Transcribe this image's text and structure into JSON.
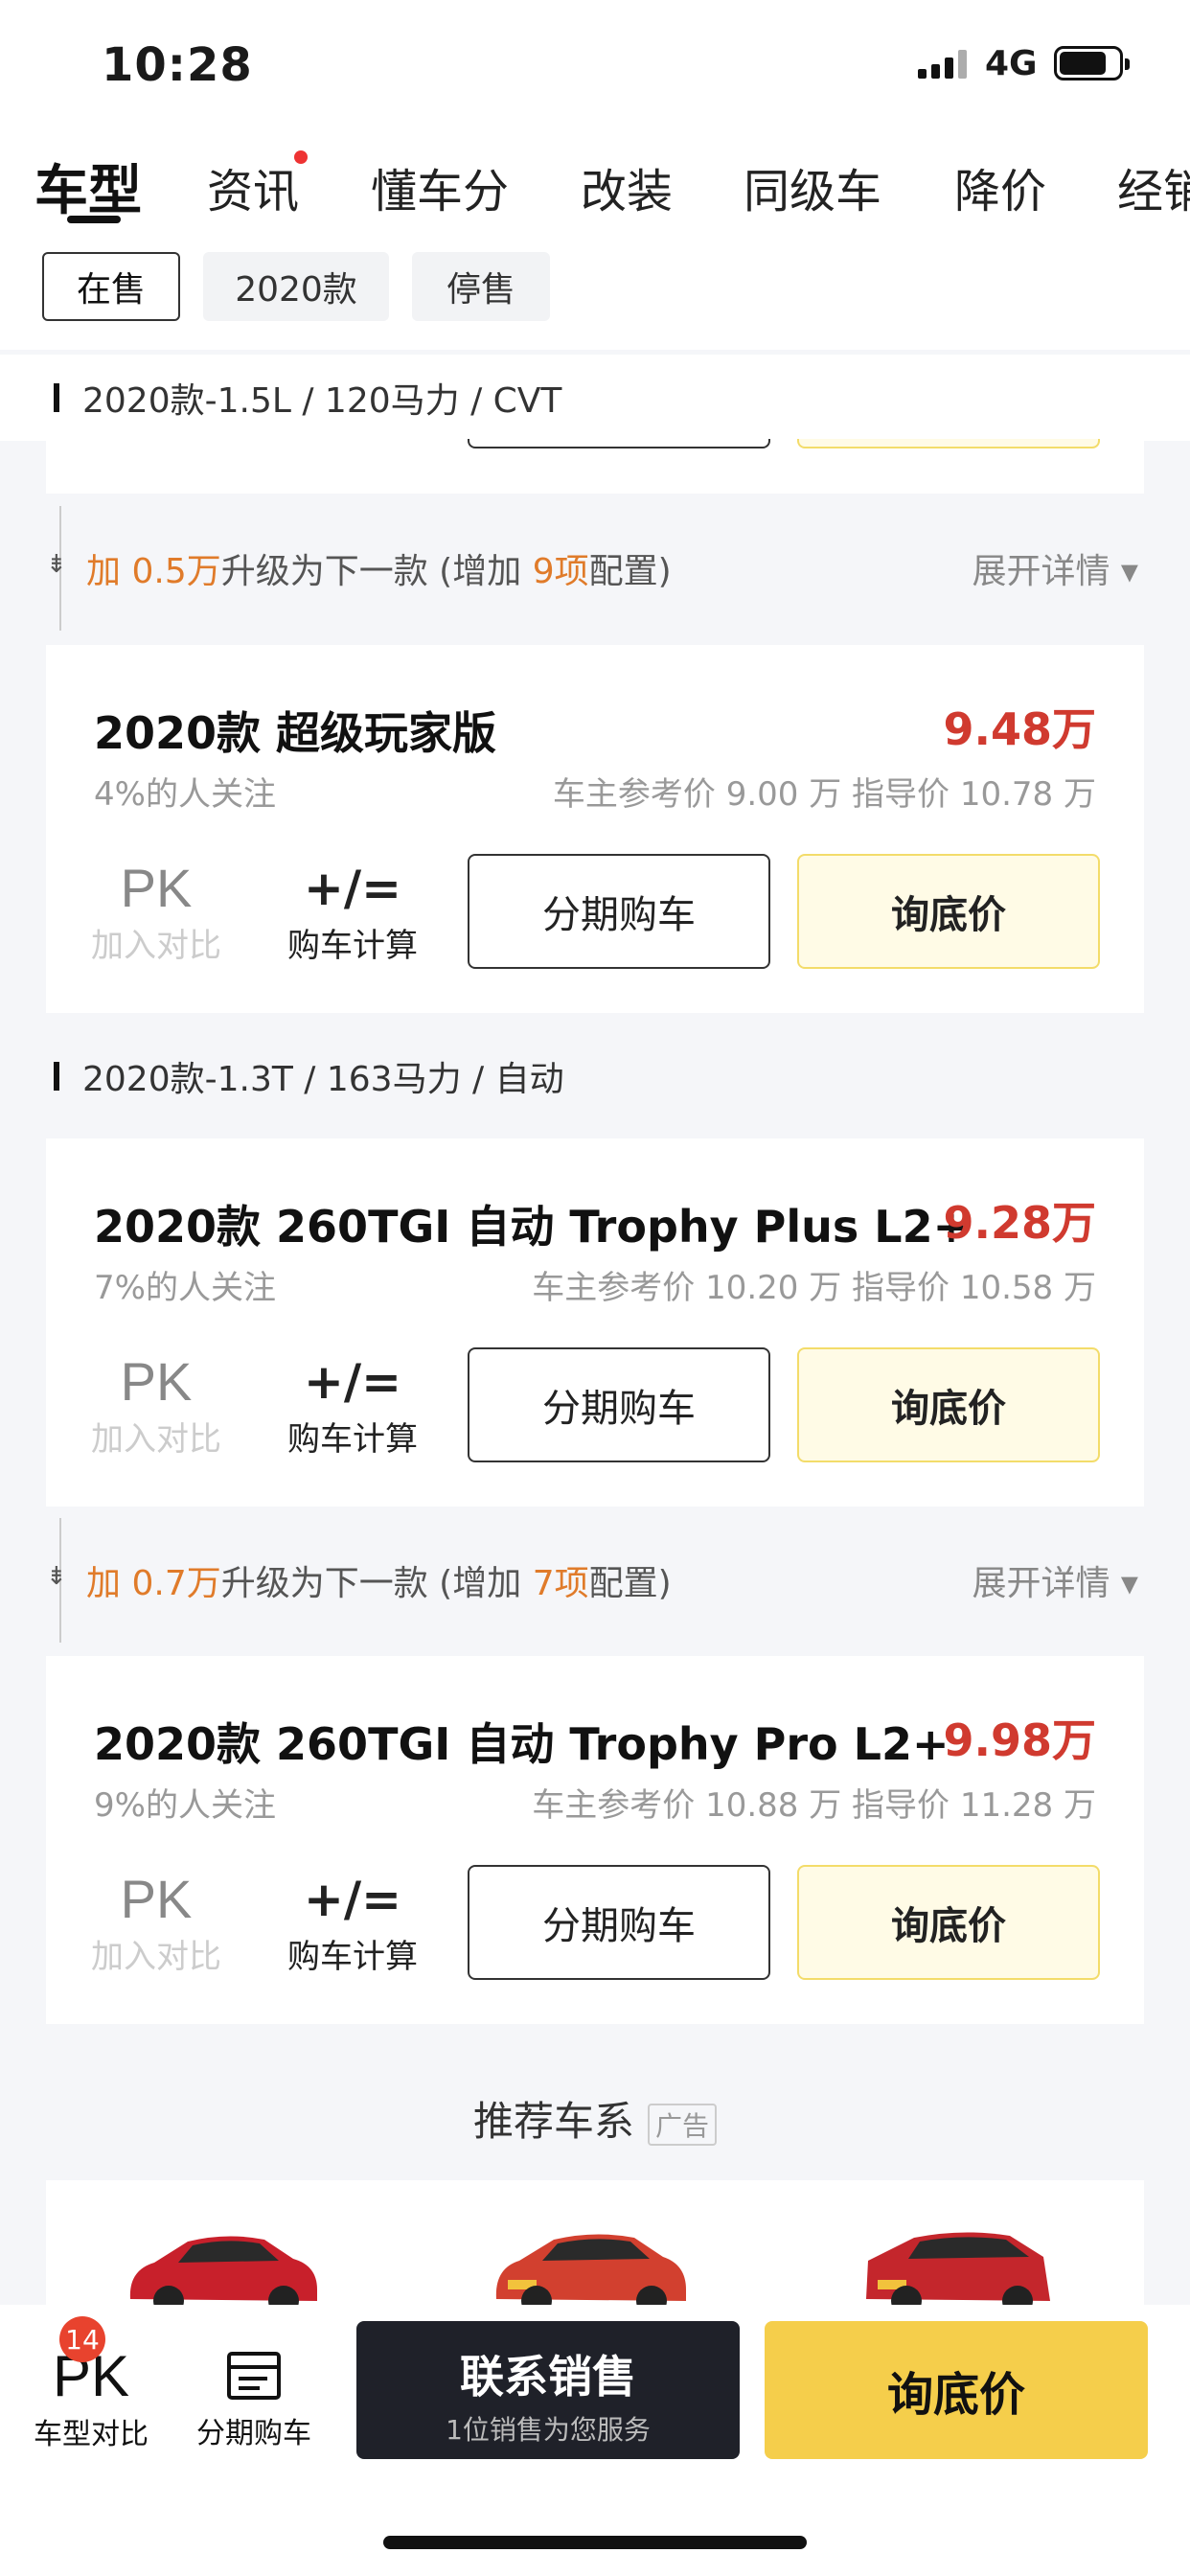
{
  "status": {
    "time": "10:28",
    "network": "4G"
  },
  "tabs": [
    {
      "label": "车型",
      "active": true
    },
    {
      "label": "资讯",
      "dot": true
    },
    {
      "label": "懂车分"
    },
    {
      "label": "改装"
    },
    {
      "label": "同级车"
    },
    {
      "label": "降价"
    },
    {
      "label": "经销"
    }
  ],
  "filters": [
    "在售",
    "2020款",
    "停售"
  ],
  "groups": {
    "g1": "2020款-1.5L / 120马力 / CVT",
    "g2": "2020款-1.3T / 163马力 / 自动"
  },
  "models": [
    {
      "title": "2020款 超级玩家版",
      "price": "9.48万",
      "attention": "4%的人关注",
      "ref": "车主参考价 9.00 万  指导价 10.78 万"
    },
    {
      "title": "2020款 260TGI 自动 Trophy Plus L2+",
      "price": "9.28万",
      "attention": "7%的人关注",
      "ref": "车主参考价 10.20 万  指导价 10.58 万"
    },
    {
      "title": "2020款 260TGI 自动 Trophy Pro L2+",
      "price": "9.98万",
      "attention": "9%的人关注",
      "ref": "车主参考价 10.88 万  指导价 11.28 万"
    }
  ],
  "card_actions": {
    "pk": "PK",
    "pk_label": "加入对比",
    "calc_icon": "+/=",
    "calc_label": "购车计算",
    "installment": "分期购车",
    "quote": "询底价"
  },
  "upgrades": [
    {
      "prefix": "加",
      "amount": "0.5万",
      "mid": "升级为下一款 (增加",
      "count": "9项",
      "suffix": "配置)",
      "more": "展开详情 ▾"
    },
    {
      "prefix": "加",
      "amount": "0.7万",
      "mid": "升级为下一款 (增加",
      "count": "7项",
      "suffix": "配置)",
      "more": "展开详情 ▾"
    }
  ],
  "recommend": {
    "title": "推荐车系",
    "ad": "广告"
  },
  "bottom": {
    "pk": "PK",
    "pk_badge": "14",
    "pk_label": "车型对比",
    "installment_label": "分期购车",
    "contact_title": "联系销售",
    "contact_sub": "1位销售为您服务",
    "quote": "询底价"
  },
  "colors": {
    "price": "#d03a2f",
    "accent_orange": "#e07b2a",
    "quote_yellow": "#f5ce4b",
    "contact_dark": "#1f2129"
  }
}
